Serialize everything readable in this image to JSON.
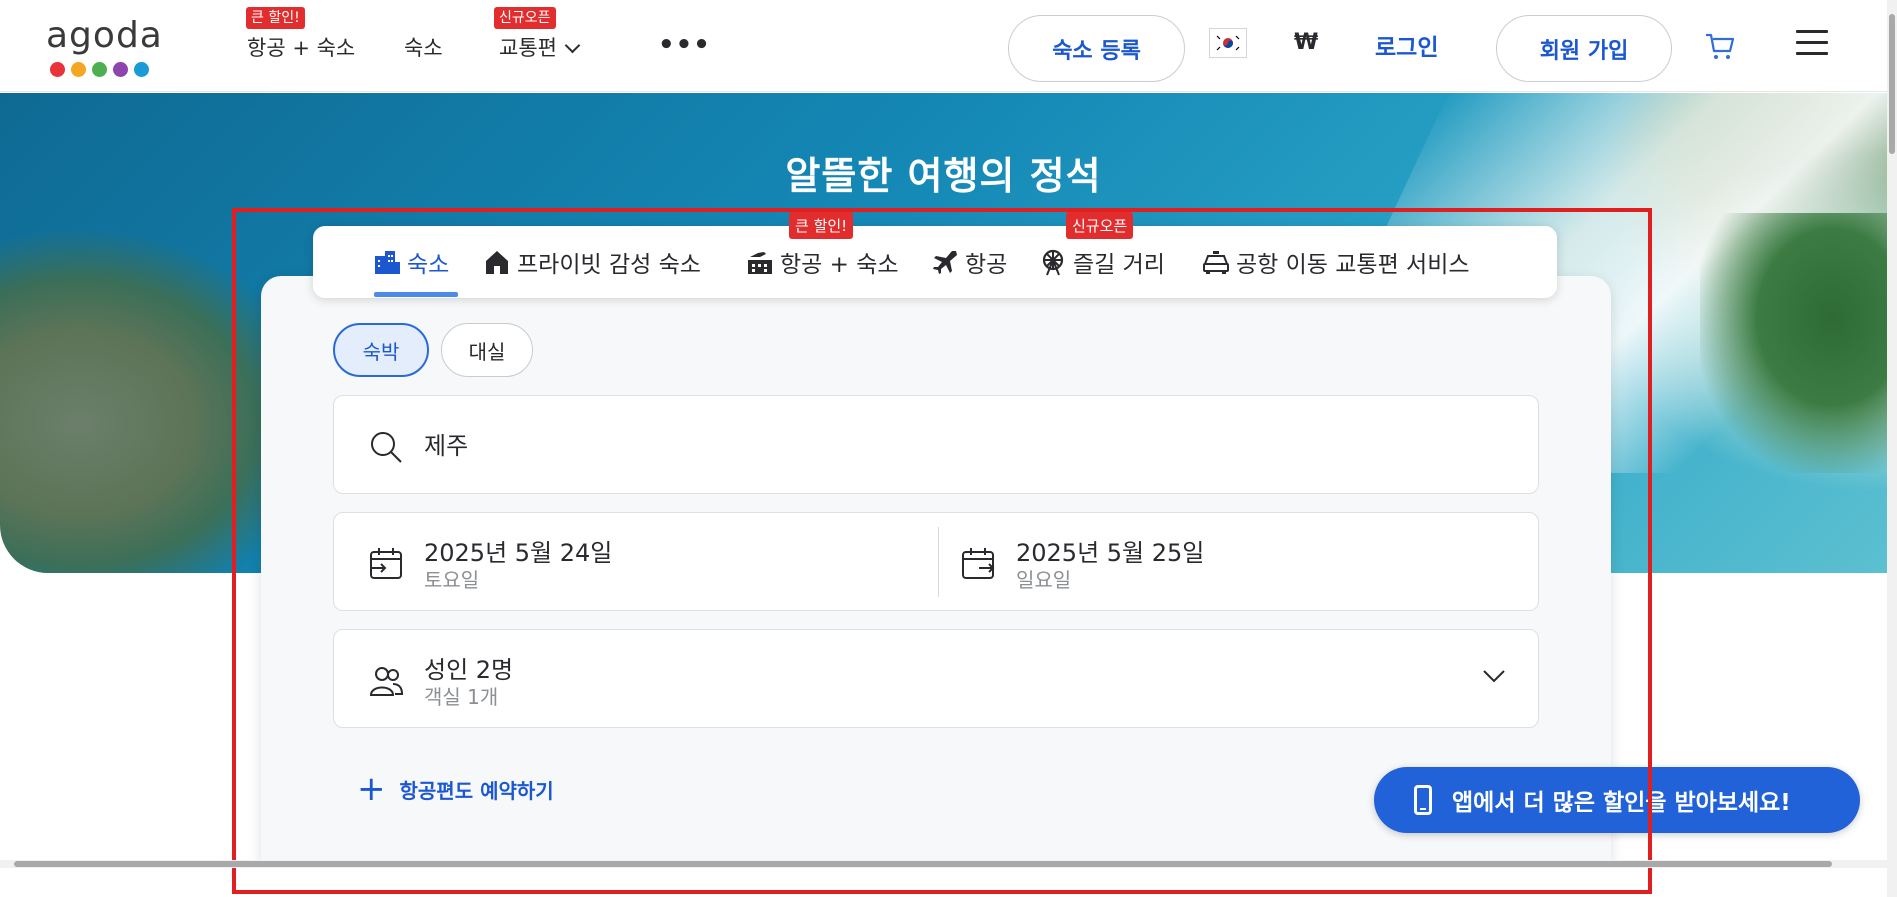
{
  "brand": {
    "logo_text": "agoda",
    "dot_colors": [
      "#e8333b",
      "#f5a623",
      "#4cb050",
      "#8e44ad",
      "#1a9ad6"
    ]
  },
  "nav": {
    "items": [
      {
        "label": "항공 + 숙소",
        "badge": "큰 할인!"
      },
      {
        "label": "숙소",
        "badge": ""
      },
      {
        "label": "교통편",
        "badge": "신규오픈"
      }
    ],
    "more": "•••"
  },
  "header_right": {
    "register_property": "숙소 등록",
    "currency": "₩",
    "login": "로그인",
    "signup": "회원 가입"
  },
  "hero": {
    "title": "알뜰한 여행의 정석"
  },
  "tabs": [
    {
      "label": "숙소",
      "icon": "hotel-icon",
      "active": true
    },
    {
      "label": "프라이빗 감성 숙소",
      "icon": "house-icon",
      "active": false
    },
    {
      "label": "항공 + 숙소",
      "icon": "flight-hotel-icon",
      "active": false,
      "badge": "큰 할인!"
    },
    {
      "label": "항공",
      "icon": "airplane-icon",
      "active": false
    },
    {
      "label": "즐길 거리",
      "icon": "ferris-wheel-icon",
      "active": false,
      "badge": "신규오픈"
    },
    {
      "label": "공항 이동 교통편 서비스",
      "icon": "car-icon",
      "active": false
    }
  ],
  "stay_type": {
    "overnight": "숙박",
    "dayuse": "대실"
  },
  "search": {
    "destination": "제주"
  },
  "dates": {
    "checkin_date": "2025년 5월 24일",
    "checkin_day": "토요일",
    "checkout_date": "2025년 5월 25일",
    "checkout_day": "일요일"
  },
  "guests": {
    "adults": "성인 2명",
    "rooms": "객실 1개"
  },
  "add_flight": {
    "plus": "+",
    "label": "항공편도 예약하기"
  },
  "app_banner": {
    "label": "앱에서 더 많은 할인을 받아보세요!"
  },
  "colors": {
    "accent": "#1b58d0",
    "badge": "#e12d2d",
    "highlight_box": "#e02020"
  }
}
